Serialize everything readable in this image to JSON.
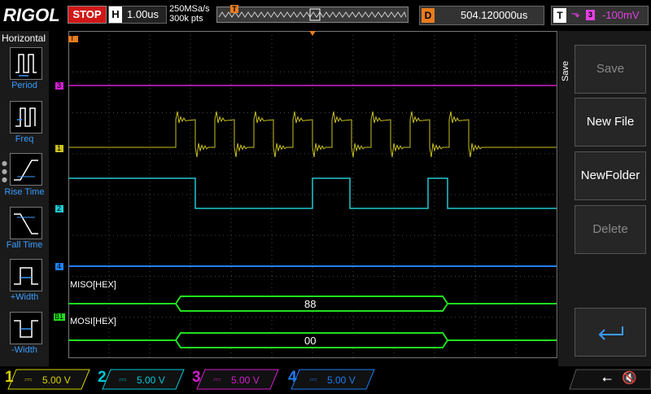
{
  "header": {
    "brand": "RIGOL",
    "run_state": "STOP",
    "horizontal_key": "H",
    "timebase": "1.00us",
    "sample_rate": "250MSa/s",
    "memory_depth": "300k pts",
    "trigger_position_marker": "T",
    "delay_key": "D",
    "delay_value": "504.120000us",
    "trigger_key": "T",
    "trigger_source": "3",
    "trigger_level": "-100mV"
  },
  "left_menu": {
    "title": "Horizontal",
    "items": [
      {
        "label": "Period",
        "icon": "period-icon"
      },
      {
        "label": "Freq",
        "icon": "frequency-icon"
      },
      {
        "label": "Rise Time",
        "icon": "rise-time-icon"
      },
      {
        "label": "Fall Time",
        "icon": "fall-time-icon"
      },
      {
        "label": "+Width",
        "icon": "positive-width-icon"
      },
      {
        "label": "-Width",
        "icon": "negative-width-icon"
      }
    ]
  },
  "right_menu": {
    "tab_label": "Save",
    "buttons": [
      {
        "label": "Save",
        "enabled": false
      },
      {
        "label": "New File",
        "enabled": true
      },
      {
        "label": "NewFolder",
        "enabled": true
      },
      {
        "label": "Delete",
        "enabled": false
      }
    ],
    "return_icon": "return-arrow-icon"
  },
  "waveform": {
    "trigger_marker": "T",
    "channel_markers": [
      "3",
      "1",
      "2",
      "4",
      "B1"
    ],
    "decode": [
      {
        "label": "MISO[HEX]",
        "value": "88"
      },
      {
        "label": "MOSI[HEX]",
        "value": "00"
      }
    ]
  },
  "channels": [
    {
      "number": "1",
      "scale": "5.00 V",
      "color": "#d8d000"
    },
    {
      "number": "2",
      "scale": "5.00 V",
      "color": "#00c8d8"
    },
    {
      "number": "3",
      "scale": "5.00 V",
      "color": "#d020c8"
    },
    {
      "number": "4",
      "scale": "5.00 V",
      "color": "#1e7cf0"
    }
  ],
  "status_icons": [
    "usb-icon",
    "speaker-muted-icon"
  ],
  "colors": {
    "ch1": "#c8c020",
    "ch2": "#20c8d0",
    "ch3": "#d020d0",
    "ch4": "#2080f0",
    "decode": "#20e020",
    "trigger": "#e87c1e"
  }
}
